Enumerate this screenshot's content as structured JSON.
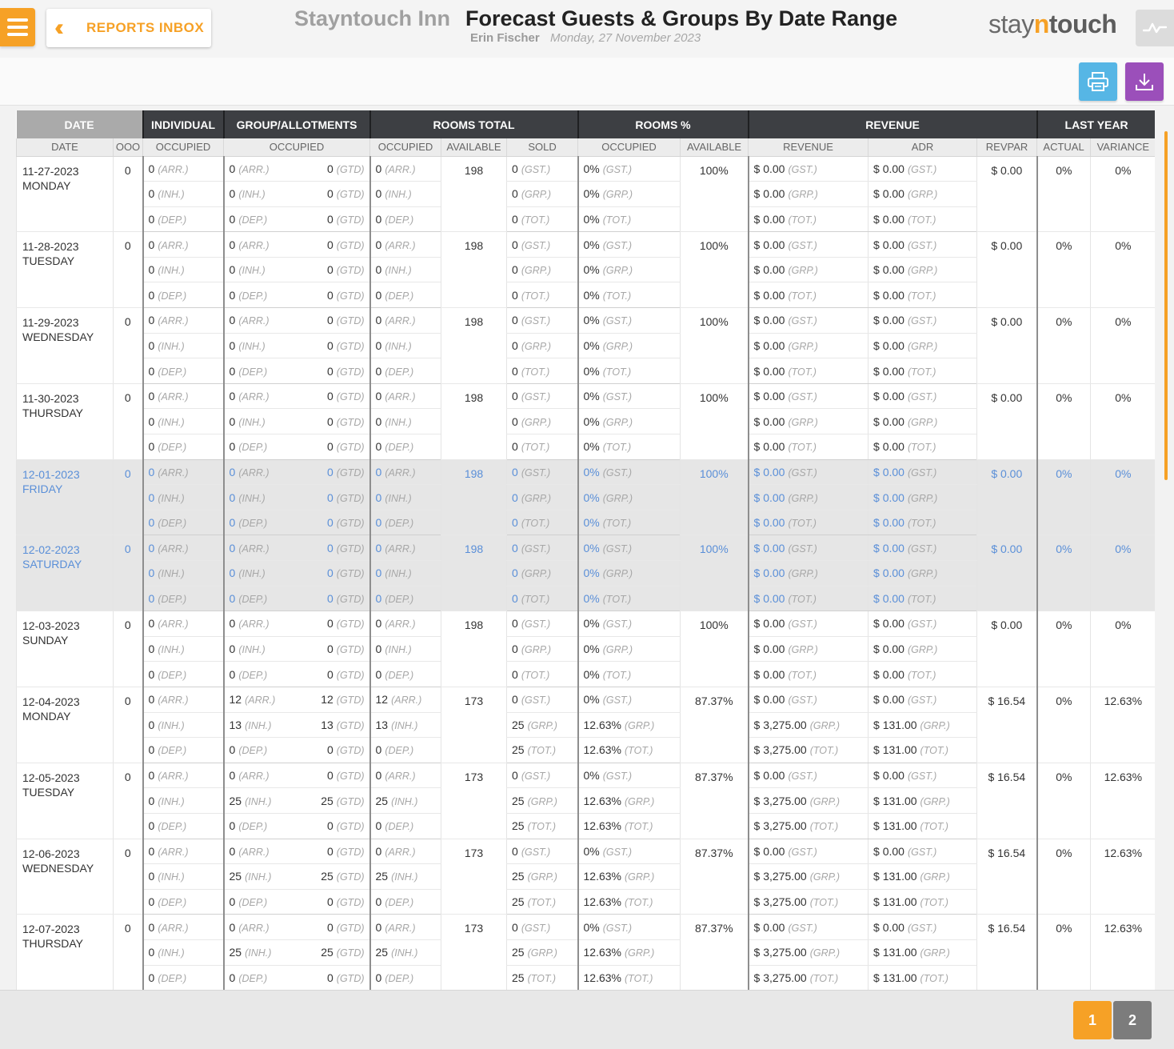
{
  "header": {
    "reports_inbox_label": "REPORTS INBOX",
    "hotel_name": "Stayntouch Inn",
    "report_title": "Forecast Guests & Groups By Date Range",
    "user_name": "Erin Fischer",
    "report_date": "Monday, 27 November 2023",
    "brand": {
      "part1": "stay",
      "part2": "n",
      "part3": "touch"
    }
  },
  "icons": [
    "menu-icon",
    "double-chevron-left-icon",
    "activity-icon",
    "print-icon",
    "download-icon"
  ],
  "colors": {
    "accent": "#f6a126",
    "print": "#56b6e5",
    "download": "#9b4fba",
    "header_dark": "#3d3f43",
    "weekend_text": "#5a8fd8"
  },
  "table": {
    "group_headers": [
      "DATE",
      "INDIVIDUAL",
      "GROUP/ALLOTMENTS",
      "ROOMS TOTAL",
      "ROOMS %",
      "REVENUE",
      "LAST YEAR"
    ],
    "sub_headers": [
      "DATE",
      "OOO",
      "OCCUPIED",
      "OCCUPIED",
      "OCCUPIED",
      "AVAILABLE",
      "SOLD",
      "OCCUPIED",
      "AVAILABLE",
      "REVENUE",
      "ADR",
      "REVPAR",
      "ACTUAL",
      "VARIANCE"
    ],
    "tags": {
      "arr": "(ARR.)",
      "inh": "(INH.)",
      "dep": "(DEP.)",
      "gtd": "(GTD)",
      "gst": "(GST.)",
      "grp": "(GRP.)",
      "tot": "(TOT.)"
    },
    "days": [
      {
        "date": "11-27-2023",
        "day": "MONDAY",
        "ooo": "0",
        "weekend": false,
        "ind": [
          "0",
          "0",
          "0"
        ],
        "grp": [
          "0",
          "0",
          "0"
        ],
        "grp_gtd": [
          "0",
          "0",
          "0"
        ],
        "tot": [
          "0",
          "0",
          "0"
        ],
        "available": "198",
        "sold": [
          "0",
          "0",
          "0"
        ],
        "occ_pct": [
          "0%",
          "0%",
          "0%"
        ],
        "avail_pct": "100%",
        "revenue": [
          "$ 0.00",
          "$ 0.00",
          "$ 0.00"
        ],
        "adr": [
          "$ 0.00",
          "$ 0.00",
          "$ 0.00"
        ],
        "revpar": "$ 0.00",
        "ly_actual": "0%",
        "ly_variance": "0%"
      },
      {
        "date": "11-28-2023",
        "day": "TUESDAY",
        "ooo": "0",
        "weekend": false,
        "ind": [
          "0",
          "0",
          "0"
        ],
        "grp": [
          "0",
          "0",
          "0"
        ],
        "grp_gtd": [
          "0",
          "0",
          "0"
        ],
        "tot": [
          "0",
          "0",
          "0"
        ],
        "available": "198",
        "sold": [
          "0",
          "0",
          "0"
        ],
        "occ_pct": [
          "0%",
          "0%",
          "0%"
        ],
        "avail_pct": "100%",
        "revenue": [
          "$ 0.00",
          "$ 0.00",
          "$ 0.00"
        ],
        "adr": [
          "$ 0.00",
          "$ 0.00",
          "$ 0.00"
        ],
        "revpar": "$ 0.00",
        "ly_actual": "0%",
        "ly_variance": "0%"
      },
      {
        "date": "11-29-2023",
        "day": "WEDNESDAY",
        "ooo": "0",
        "weekend": false,
        "ind": [
          "0",
          "0",
          "0"
        ],
        "grp": [
          "0",
          "0",
          "0"
        ],
        "grp_gtd": [
          "0",
          "0",
          "0"
        ],
        "tot": [
          "0",
          "0",
          "0"
        ],
        "available": "198",
        "sold": [
          "0",
          "0",
          "0"
        ],
        "occ_pct": [
          "0%",
          "0%",
          "0%"
        ],
        "avail_pct": "100%",
        "revenue": [
          "$ 0.00",
          "$ 0.00",
          "$ 0.00"
        ],
        "adr": [
          "$ 0.00",
          "$ 0.00",
          "$ 0.00"
        ],
        "revpar": "$ 0.00",
        "ly_actual": "0%",
        "ly_variance": "0%"
      },
      {
        "date": "11-30-2023",
        "day": "THURSDAY",
        "ooo": "0",
        "weekend": false,
        "ind": [
          "0",
          "0",
          "0"
        ],
        "grp": [
          "0",
          "0",
          "0"
        ],
        "grp_gtd": [
          "0",
          "0",
          "0"
        ],
        "tot": [
          "0",
          "0",
          "0"
        ],
        "available": "198",
        "sold": [
          "0",
          "0",
          "0"
        ],
        "occ_pct": [
          "0%",
          "0%",
          "0%"
        ],
        "avail_pct": "100%",
        "revenue": [
          "$ 0.00",
          "$ 0.00",
          "$ 0.00"
        ],
        "adr": [
          "$ 0.00",
          "$ 0.00",
          "$ 0.00"
        ],
        "revpar": "$ 0.00",
        "ly_actual": "0%",
        "ly_variance": "0%"
      },
      {
        "date": "12-01-2023",
        "day": "FRIDAY",
        "ooo": "0",
        "weekend": true,
        "ind": [
          "0",
          "0",
          "0"
        ],
        "grp": [
          "0",
          "0",
          "0"
        ],
        "grp_gtd": [
          "0",
          "0",
          "0"
        ],
        "tot": [
          "0",
          "0",
          "0"
        ],
        "available": "198",
        "sold": [
          "0",
          "0",
          "0"
        ],
        "occ_pct": [
          "0%",
          "0%",
          "0%"
        ],
        "avail_pct": "100%",
        "revenue": [
          "$ 0.00",
          "$ 0.00",
          "$ 0.00"
        ],
        "adr": [
          "$ 0.00",
          "$ 0.00",
          "$ 0.00"
        ],
        "revpar": "$ 0.00",
        "ly_actual": "0%",
        "ly_variance": "0%"
      },
      {
        "date": "12-02-2023",
        "day": "SATURDAY",
        "ooo": "0",
        "weekend": true,
        "ind": [
          "0",
          "0",
          "0"
        ],
        "grp": [
          "0",
          "0",
          "0"
        ],
        "grp_gtd": [
          "0",
          "0",
          "0"
        ],
        "tot": [
          "0",
          "0",
          "0"
        ],
        "available": "198",
        "sold": [
          "0",
          "0",
          "0"
        ],
        "occ_pct": [
          "0%",
          "0%",
          "0%"
        ],
        "avail_pct": "100%",
        "revenue": [
          "$ 0.00",
          "$ 0.00",
          "$ 0.00"
        ],
        "adr": [
          "$ 0.00",
          "$ 0.00",
          "$ 0.00"
        ],
        "revpar": "$ 0.00",
        "ly_actual": "0%",
        "ly_variance": "0%"
      },
      {
        "date": "12-03-2023",
        "day": "SUNDAY",
        "ooo": "0",
        "weekend": false,
        "ind": [
          "0",
          "0",
          "0"
        ],
        "grp": [
          "0",
          "0",
          "0"
        ],
        "grp_gtd": [
          "0",
          "0",
          "0"
        ],
        "tot": [
          "0",
          "0",
          "0"
        ],
        "available": "198",
        "sold": [
          "0",
          "0",
          "0"
        ],
        "occ_pct": [
          "0%",
          "0%",
          "0%"
        ],
        "avail_pct": "100%",
        "revenue": [
          "$ 0.00",
          "$ 0.00",
          "$ 0.00"
        ],
        "adr": [
          "$ 0.00",
          "$ 0.00",
          "$ 0.00"
        ],
        "revpar": "$ 0.00",
        "ly_actual": "0%",
        "ly_variance": "0%"
      },
      {
        "date": "12-04-2023",
        "day": "MONDAY",
        "ooo": "0",
        "weekend": false,
        "ind": [
          "0",
          "0",
          "0"
        ],
        "grp": [
          "12",
          "13",
          "0"
        ],
        "grp_gtd": [
          "12",
          "13",
          "0"
        ],
        "tot": [
          "12",
          "13",
          "0"
        ],
        "available": "173",
        "sold": [
          "0",
          "25",
          "25"
        ],
        "occ_pct": [
          "0%",
          "12.63%",
          "12.63%"
        ],
        "avail_pct": "87.37%",
        "revenue": [
          "$ 0.00",
          "$ 3,275.00",
          "$ 3,275.00"
        ],
        "adr": [
          "$ 0.00",
          "$ 131.00",
          "$ 131.00"
        ],
        "revpar": "$ 16.54",
        "ly_actual": "0%",
        "ly_variance": "12.63%"
      },
      {
        "date": "12-05-2023",
        "day": "TUESDAY",
        "ooo": "0",
        "weekend": false,
        "ind": [
          "0",
          "0",
          "0"
        ],
        "grp": [
          "0",
          "25",
          "0"
        ],
        "grp_gtd": [
          "0",
          "25",
          "0"
        ],
        "tot": [
          "0",
          "25",
          "0"
        ],
        "available": "173",
        "sold": [
          "0",
          "25",
          "25"
        ],
        "occ_pct": [
          "0%",
          "12.63%",
          "12.63%"
        ],
        "avail_pct": "87.37%",
        "revenue": [
          "$ 0.00",
          "$ 3,275.00",
          "$ 3,275.00"
        ],
        "adr": [
          "$ 0.00",
          "$ 131.00",
          "$ 131.00"
        ],
        "revpar": "$ 16.54",
        "ly_actual": "0%",
        "ly_variance": "12.63%"
      },
      {
        "date": "12-06-2023",
        "day": "WEDNESDAY",
        "ooo": "0",
        "weekend": false,
        "ind": [
          "0",
          "0",
          "0"
        ],
        "grp": [
          "0",
          "25",
          "0"
        ],
        "grp_gtd": [
          "0",
          "25",
          "0"
        ],
        "tot": [
          "0",
          "25",
          "0"
        ],
        "available": "173",
        "sold": [
          "0",
          "25",
          "25"
        ],
        "occ_pct": [
          "0%",
          "12.63%",
          "12.63%"
        ],
        "avail_pct": "87.37%",
        "revenue": [
          "$ 0.00",
          "$ 3,275.00",
          "$ 3,275.00"
        ],
        "adr": [
          "$ 0.00",
          "$ 131.00",
          "$ 131.00"
        ],
        "revpar": "$ 16.54",
        "ly_actual": "0%",
        "ly_variance": "12.63%"
      },
      {
        "date": "12-07-2023",
        "day": "THURSDAY",
        "ooo": "0",
        "weekend": false,
        "ind": [
          "0",
          "0",
          "0"
        ],
        "grp": [
          "0",
          "25",
          "0"
        ],
        "grp_gtd": [
          "0",
          "25",
          "0"
        ],
        "tot": [
          "0",
          "25",
          "0"
        ],
        "available": "173",
        "sold": [
          "0",
          "25",
          "25"
        ],
        "occ_pct": [
          "0%",
          "12.63%",
          "12.63%"
        ],
        "avail_pct": "87.37%",
        "revenue": [
          "$ 0.00",
          "$ 3,275.00",
          "$ 3,275.00"
        ],
        "adr": [
          "$ 0.00",
          "$ 131.00",
          "$ 131.00"
        ],
        "revpar": "$ 16.54",
        "ly_actual": "0%",
        "ly_variance": "12.63%"
      }
    ]
  },
  "pagination": {
    "pages": [
      "1",
      "2"
    ],
    "current": "1"
  }
}
